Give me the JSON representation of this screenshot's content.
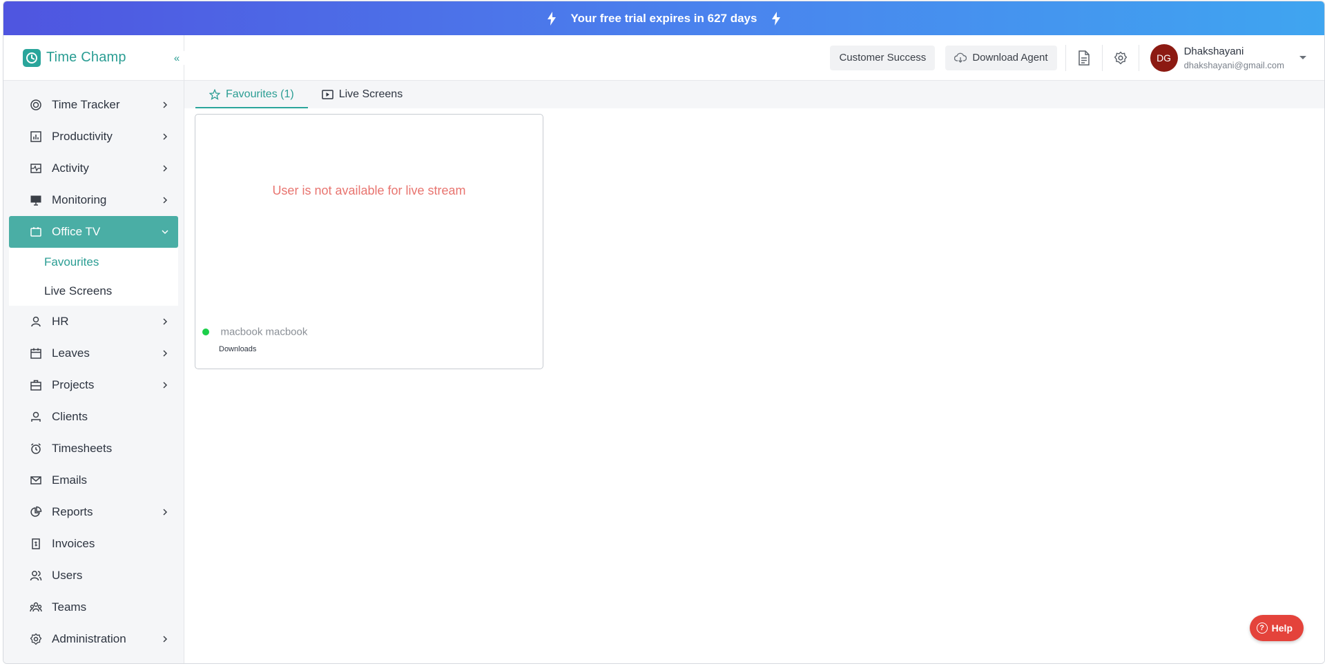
{
  "banner": {
    "text": "Your free trial expires in 627 days"
  },
  "brand": {
    "name": "Time Champ",
    "collapse_glyph": "«"
  },
  "sidebar": {
    "items": [
      {
        "label": "Time Tracker",
        "icon": "time-tracker-icon",
        "has_children": true
      },
      {
        "label": "Productivity",
        "icon": "bar-chart-icon",
        "has_children": true
      },
      {
        "label": "Activity",
        "icon": "activity-icon",
        "has_children": true
      },
      {
        "label": "Monitoring",
        "icon": "monitor-icon",
        "has_children": true
      },
      {
        "label": "Office TV",
        "icon": "tv-icon",
        "has_children": true,
        "expanded": true
      },
      {
        "label": "HR",
        "icon": "person-icon",
        "has_children": true
      },
      {
        "label": "Leaves",
        "icon": "calendar-icon",
        "has_children": true
      },
      {
        "label": "Projects",
        "icon": "briefcase-icon",
        "has_children": true
      },
      {
        "label": "Clients",
        "icon": "client-icon",
        "has_children": false
      },
      {
        "label": "Timesheets",
        "icon": "alarm-clock-icon",
        "has_children": false
      },
      {
        "label": "Emails",
        "icon": "mail-icon",
        "has_children": false
      },
      {
        "label": "Reports",
        "icon": "pie-chart-icon",
        "has_children": true
      },
      {
        "label": "Invoices",
        "icon": "invoice-icon",
        "has_children": false
      },
      {
        "label": "Users",
        "icon": "users-icon",
        "has_children": false
      },
      {
        "label": "Teams",
        "icon": "teams-icon",
        "has_children": false
      },
      {
        "label": "Administration",
        "icon": "gear-icon",
        "has_children": true
      }
    ],
    "office_tv_sub": [
      {
        "label": "Favourites",
        "active": true
      },
      {
        "label": "Live Screens",
        "active": false
      }
    ]
  },
  "header": {
    "customer_success": "Customer Success",
    "download_agent": "Download Agent",
    "user": {
      "initials": "DG",
      "name": "Dhakshayani",
      "email": "dhakshayani@gmail.com"
    }
  },
  "tabs": [
    {
      "label": "Favourites (1)",
      "active": true
    },
    {
      "label": "Live Screens",
      "active": false
    }
  ],
  "card": {
    "message": "User is not available for live stream",
    "user": "macbook macbook",
    "app": "Downloads",
    "status_color": "#1ccf4a"
  },
  "help": {
    "label": "Help"
  },
  "colors": {
    "accent": "#2aa59b",
    "active_nav": "#4aaea5",
    "help": "#e4433b",
    "avatar": "#8c1a12"
  }
}
